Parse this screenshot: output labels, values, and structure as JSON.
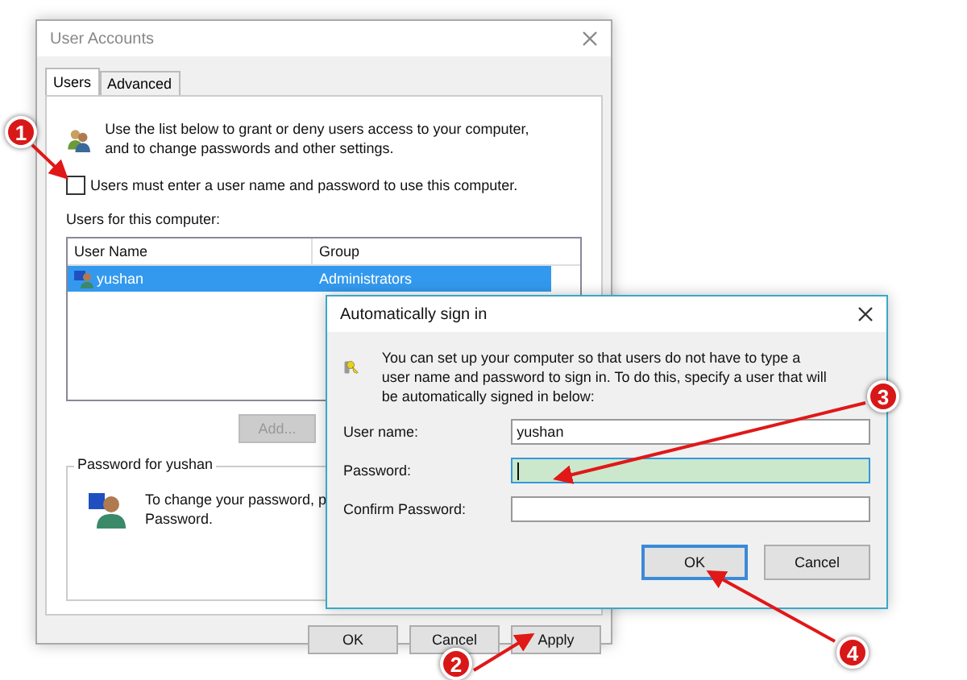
{
  "main_window": {
    "title": "User Accounts",
    "tabs": [
      {
        "label": "Users",
        "selected": true
      },
      {
        "label": "Advanced",
        "selected": false
      }
    ],
    "intro": "Use the list below to grant or deny users access to your computer, and to change passwords and other settings.",
    "require_password": {
      "label": "Users must enter a user name and password to use this computer.",
      "checked": false
    },
    "users_label": "Users for this computer:",
    "table": {
      "columns": [
        "User Name",
        "Group"
      ],
      "rows": [
        {
          "cells": [
            "yushan",
            "Administrators"
          ],
          "selected": true
        }
      ]
    },
    "add_button": {
      "label": "Add...",
      "disabled": true
    },
    "password_group": {
      "title": "Password for yushan",
      "lines": [
        "To change your password, p",
        "Password."
      ]
    },
    "buttons": [
      "OK",
      "Cancel",
      "Apply"
    ]
  },
  "dialog": {
    "title": "Automatically sign in",
    "description": "You can set up your computer so that users do not have to type a user name and password to sign in. To do this, specify a user that will be automatically signed in below:",
    "fields": [
      {
        "label": "User name:",
        "value": "yushan",
        "focused": false
      },
      {
        "label": "Password:",
        "focused": true
      },
      {
        "label": "Confirm Password:",
        "focused": false
      }
    ],
    "buttons": [
      {
        "label": "OK",
        "default": true
      },
      {
        "label": "Cancel",
        "default": false
      }
    ]
  },
  "annotations": [
    {
      "number": "1"
    },
    {
      "number": "2"
    },
    {
      "number": "3"
    },
    {
      "number": "4"
    }
  ]
}
